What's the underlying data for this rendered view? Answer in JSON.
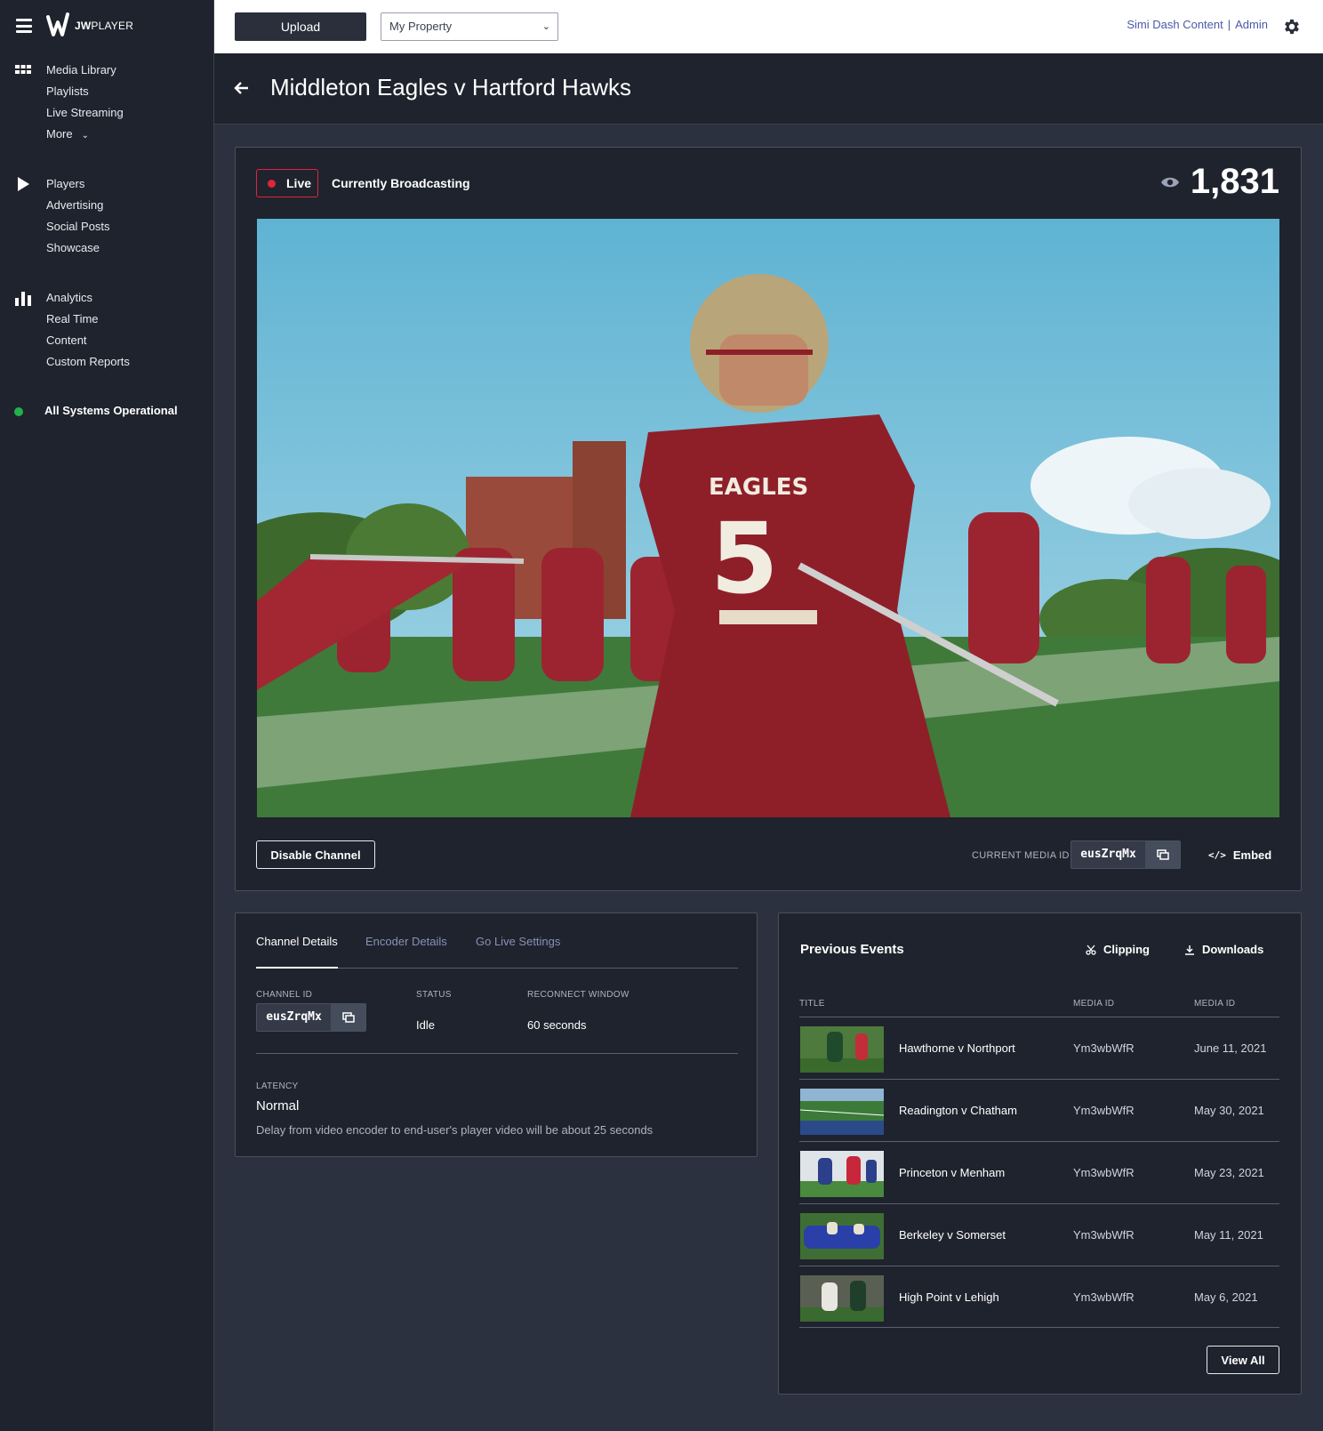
{
  "sidebar": {
    "logo_text": "JW",
    "logo_text_thin": "PLAYER",
    "groups": [
      {
        "icon": "grid-icon",
        "items": [
          "Media Library",
          "Playlists",
          "Live Streaming",
          "More"
        ]
      },
      {
        "icon": "play-icon",
        "items": [
          "Players",
          "Advertising",
          "Social Posts",
          "Showcase"
        ]
      },
      {
        "icon": "bar-chart-icon",
        "items": [
          "Analytics",
          "Real Time",
          "Content",
          "Custom Reports"
        ]
      }
    ],
    "status": "All Systems Operational",
    "status_color": "#22b14c"
  },
  "topbar": {
    "upload_label": "Upload",
    "property_value": "My Property",
    "user_org": "Simi Dash Content",
    "user_separator": "|",
    "user_role": "Admin"
  },
  "page": {
    "title": "Middleton Eagles v Hartford Hawks"
  },
  "live": {
    "badge": "Live",
    "status": "Currently Broadcasting",
    "viewer_count": "1,831",
    "accent_color": "#e0243a",
    "disable_label": "Disable Channel",
    "media_id_label": "CURRENT MEDIA ID",
    "media_id": "eusZrqMx",
    "embed_label": "Embed"
  },
  "details": {
    "tabs": [
      "Channel Details",
      "Encoder Details",
      "Go Live Settings"
    ],
    "channel_id_label": "CHANNEL ID",
    "channel_id": "eusZrqMx",
    "status_label": "STATUS",
    "status_value": "Idle",
    "reconnect_label": "RECONNECT WINDOW",
    "reconnect_value": "60 seconds",
    "latency_label": "LATENCY",
    "latency_value": "Normal",
    "latency_desc": "Delay from video encoder to end-user's player video will be about 25 seconds"
  },
  "events": {
    "title": "Previous Events",
    "clipping_label": "Clipping",
    "downloads_label": "Downloads",
    "columns": [
      "TITLE",
      "MEDIA ID",
      "MEDIA ID"
    ],
    "rows": [
      {
        "title": "Hawthorne v Northport",
        "media_id": "Ym3wbWfR",
        "date": "June 11, 2021"
      },
      {
        "title": "Readington v Chatham",
        "media_id": "Ym3wbWfR",
        "date": "May 30, 2021"
      },
      {
        "title": "Princeton v Menham",
        "media_id": "Ym3wbWfR",
        "date": "May 23, 2021"
      },
      {
        "title": "Berkeley v Somerset",
        "media_id": "Ym3wbWfR",
        "date": "May 11, 2021"
      },
      {
        "title": "High Point v Lehigh",
        "media_id": "Ym3wbWfR",
        "date": "May 6, 2021"
      }
    ],
    "view_all_label": "View All"
  }
}
